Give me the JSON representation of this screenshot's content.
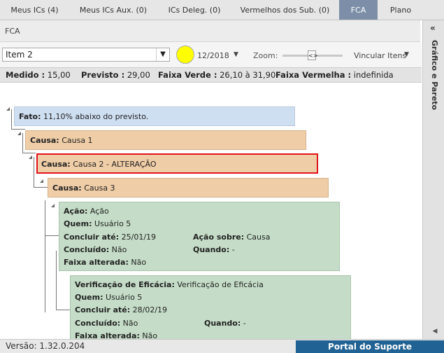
{
  "tabs": [
    {
      "label": "Meus ICs (4)"
    },
    {
      "label": "Meus ICs Aux. (0)"
    },
    {
      "label": "ICs Deleg. (0)"
    },
    {
      "label": "Vermelhos dos Sub. (0)"
    },
    {
      "label": "FCA"
    },
    {
      "label": "Plano"
    }
  ],
  "section_title": "FCA",
  "toolbar": {
    "item_select_value": "Item 2",
    "status_color": "#ffff00",
    "period": "12/2018",
    "zoom_label": "Zoom:",
    "link_label": "Vincular Itens"
  },
  "metrics": {
    "medido_label": "Medido :",
    "medido_value": " 15,00",
    "previsto_label": "Previsto :",
    "previsto_value": " 29,00",
    "verde_label": "Faixa Verde :",
    "verde_value": " 26,10 à 31,90",
    "vermelha_label": "Faixa Vermelha :",
    "vermelha_value": " indefinida"
  },
  "fato": {
    "label": "Fato:",
    "text": " 11,10% abaixo do previsto."
  },
  "causas": [
    {
      "label": "Causa:",
      "text": " Causa 1"
    },
    {
      "label": "Causa:",
      "text": " Causa 2 - ALTERAÇÃO"
    },
    {
      "label": "Causa:",
      "text": " Causa 3"
    }
  ],
  "acao": {
    "acao_label": "Ação:",
    "acao_value": " Ação",
    "quem_label": "Quem:",
    "quem_value": " Usuário 5",
    "concluir_label": "Concluir até:",
    "concluir_value": " 25/01/19",
    "sobre_label": "Ação sobre:",
    "sobre_value": " Causa",
    "concluido_label": "Concluído:",
    "concluido_value": " Não",
    "quando_label": "Quando:",
    "quando_value": " -",
    "faixa_label": "Faixa alterada:",
    "faixa_value": " Não"
  },
  "verificacao": {
    "ver_label": "Verificação de Eficácia:",
    "ver_value": " Verificação de Eficácia",
    "quem_label": "Quem:",
    "quem_value": " Usuário 5",
    "concluir_label": "Concluir até:",
    "concluir_value": " 28/02/19",
    "concluido_label": "Concluído:",
    "concluido_value": " Não",
    "quando_label": "Quando:",
    "quando_value": " -",
    "faixa_label": "Faixa alterada:",
    "faixa_value": " Não"
  },
  "side_panel": {
    "collapse_glyph": "«",
    "label": "Gráfico e Pareto"
  },
  "footer": {
    "version_label": "Versão:",
    "version_value": " 1.32.0.204",
    "portal_label": "Portal do Suporte"
  },
  "colors": {
    "accent": "#1f6293",
    "tab_active": "#7d8fa8",
    "selected_border": "#e0141b",
    "fato": "#cfdff2",
    "causa": "#efcda7",
    "acao": "#c5ddc8"
  }
}
